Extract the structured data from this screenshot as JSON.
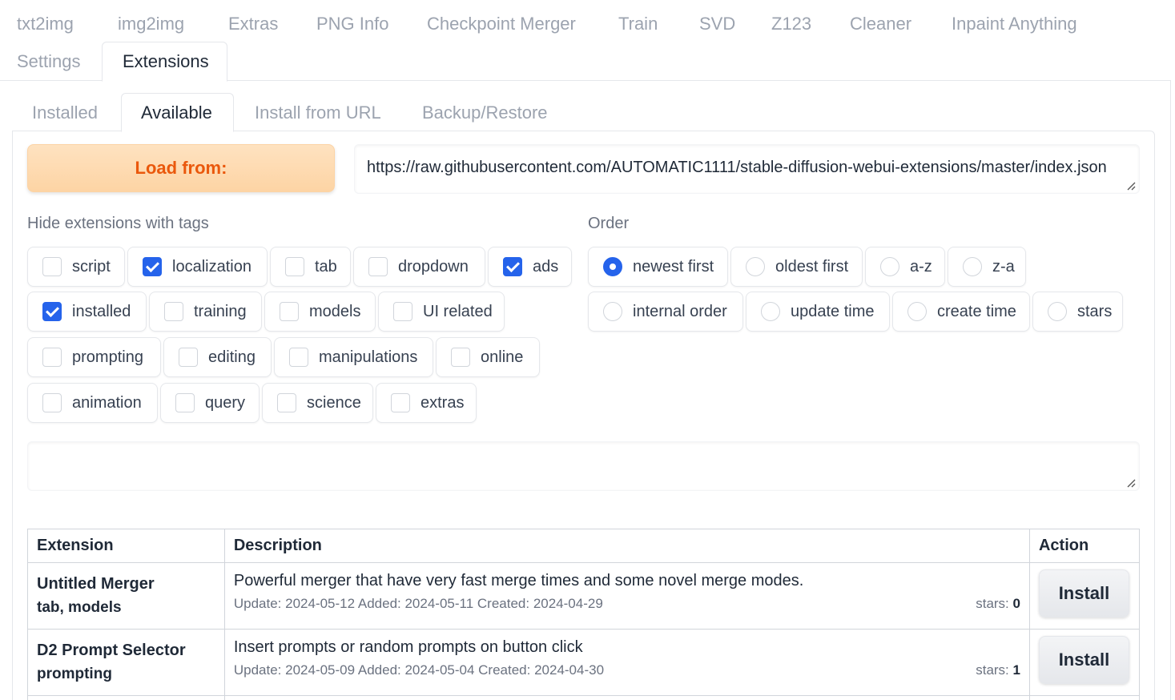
{
  "top_tabs": [
    {
      "label": "txt2img"
    },
    {
      "label": "img2img"
    },
    {
      "label": "Extras"
    },
    {
      "label": "PNG Info"
    },
    {
      "label": "Checkpoint Merger"
    },
    {
      "label": "Train"
    },
    {
      "label": "SVD"
    },
    {
      "label": "Z123"
    },
    {
      "label": "Cleaner"
    },
    {
      "label": "Inpaint Anything"
    },
    {
      "label": "Settings"
    },
    {
      "label": "Extensions"
    }
  ],
  "active_top_tab": "Extensions",
  "sub_tabs": [
    {
      "label": "Installed"
    },
    {
      "label": "Available"
    },
    {
      "label": "Install from URL"
    },
    {
      "label": "Backup/Restore"
    }
  ],
  "active_sub_tab": "Available",
  "load_button": {
    "label": "Load from:"
  },
  "index_url": {
    "value": "https://raw.githubusercontent.com/AUTOMATIC1111/stable-diffusion-webui-extensions/master/index.json"
  },
  "hide_tags": {
    "label": "Hide extensions with tags",
    "items": [
      {
        "label": "script",
        "checked": false
      },
      {
        "label": "localization",
        "checked": true
      },
      {
        "label": "tab",
        "checked": false
      },
      {
        "label": "dropdown",
        "checked": false
      },
      {
        "label": "ads",
        "checked": true
      },
      {
        "label": "installed",
        "checked": true
      },
      {
        "label": "training",
        "checked": false
      },
      {
        "label": "models",
        "checked": false
      },
      {
        "label": "UI related",
        "checked": false
      },
      {
        "label": "prompting",
        "checked": false
      },
      {
        "label": "editing",
        "checked": false
      },
      {
        "label": "manipulations",
        "checked": false
      },
      {
        "label": "online",
        "checked": false
      },
      {
        "label": "animation",
        "checked": false
      },
      {
        "label": "query",
        "checked": false
      },
      {
        "label": "science",
        "checked": false
      },
      {
        "label": "extras",
        "checked": false
      }
    ]
  },
  "order": {
    "label": "Order",
    "items": [
      {
        "label": "newest first",
        "selected": true
      },
      {
        "label": "oldest first",
        "selected": false
      },
      {
        "label": "a-z",
        "selected": false
      },
      {
        "label": "z-a",
        "selected": false
      },
      {
        "label": "internal order",
        "selected": false
      },
      {
        "label": "update time",
        "selected": false
      },
      {
        "label": "create time",
        "selected": false
      },
      {
        "label": "stars",
        "selected": false
      }
    ]
  },
  "search": {
    "value": ""
  },
  "table": {
    "headers": {
      "extension": "Extension",
      "description": "Description",
      "action": "Action"
    },
    "rows": [
      {
        "name": "Untitled Merger",
        "tags": "tab, models",
        "description": "Powerful merger that have very fast merge times and some novel merge modes.",
        "dates": "Update: 2024-05-12 Added: 2024-05-11 Created: 2024-04-29",
        "stars_label": "stars:",
        "stars": "0",
        "action": "Install"
      },
      {
        "name": "D2 Prompt Selector",
        "tags": "prompting",
        "description": "Insert prompts or random prompts on button click",
        "dates": "Update: 2024-05-09 Added: 2024-05-04 Created: 2024-04-30",
        "stars_label": "stars:",
        "stars": "1",
        "action": "Install"
      }
    ]
  },
  "colors": {
    "accent": "#2563eb",
    "load_button_text": "#ea580c",
    "load_button_bg": "#fdd4a4"
  }
}
